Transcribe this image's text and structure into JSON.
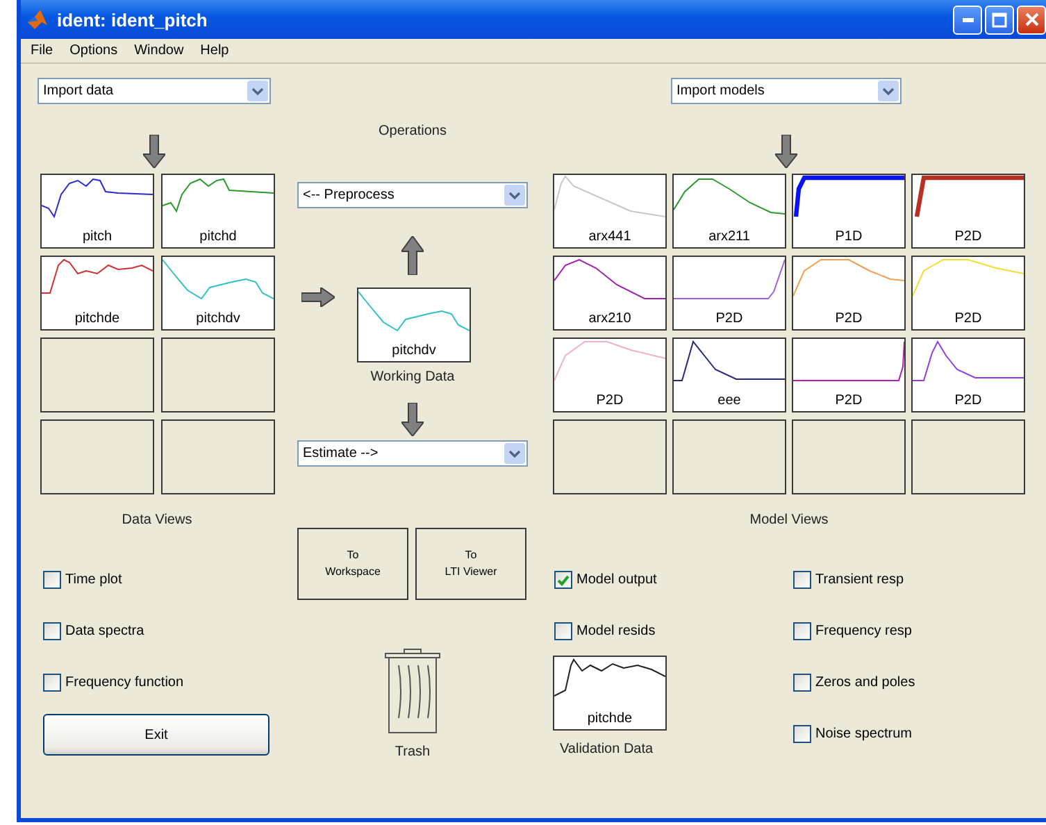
{
  "window": {
    "title": "ident: ident_pitch"
  },
  "menu": [
    "File",
    "Options",
    "Window",
    "Help"
  ],
  "import_data": {
    "value": "Import data"
  },
  "import_models": {
    "value": "Import models"
  },
  "operations": {
    "title": "Operations",
    "preprocess": "<-- Preprocess",
    "estimate": "Estimate -->"
  },
  "data_tiles": [
    {
      "kind": "plot",
      "label": "pitch",
      "color": "#2a2ad0",
      "active": false
    },
    {
      "kind": "plot",
      "label": "pitchd",
      "color": "#2a9a2a",
      "active": false
    },
    {
      "kind": "plot",
      "label": "pitchde",
      "color": "#d03030",
      "active": false
    },
    {
      "kind": "plot",
      "label": "pitchdv",
      "color": "#30c0c8",
      "active": false
    },
    {
      "kind": "empty"
    },
    {
      "kind": "empty"
    },
    {
      "kind": "empty"
    },
    {
      "kind": "empty"
    }
  ],
  "working_data": {
    "label": "pitchdv",
    "color": "#30c0c8",
    "caption": "Working Data"
  },
  "model_tiles": [
    {
      "kind": "plot",
      "label": "arx441",
      "color": "#c8c8c8",
      "active": false
    },
    {
      "kind": "plot",
      "label": "arx211",
      "color": "#2a9a2a",
      "active": false
    },
    {
      "kind": "plot",
      "label": "P1D",
      "color": "#0a14f0",
      "active": true
    },
    {
      "kind": "plot",
      "label": "P2D",
      "color": "#b83020",
      "active": true
    },
    {
      "kind": "plot",
      "label": "arx210",
      "color": "#a020b0",
      "active": false
    },
    {
      "kind": "plot",
      "label": "P2D",
      "color": "#a060e0",
      "active": false
    },
    {
      "kind": "plot",
      "label": "P2D",
      "color": "#f0a050",
      "active": false
    },
    {
      "kind": "plot",
      "label": "P2D",
      "color": "#f0e030",
      "active": false
    },
    {
      "kind": "plot",
      "label": "P2D",
      "color": "#f0b0c8",
      "active": false
    },
    {
      "kind": "plot",
      "label": "eee",
      "color": "#282880",
      "active": false
    },
    {
      "kind": "plot",
      "label": "P2D",
      "color": "#b020b0",
      "active": false
    },
    {
      "kind": "plot",
      "label": "P2D",
      "color": "#9040e0",
      "active": false
    },
    {
      "kind": "empty"
    },
    {
      "kind": "empty"
    },
    {
      "kind": "empty"
    },
    {
      "kind": "empty"
    }
  ],
  "data_views": {
    "title": "Data Views",
    "options": [
      {
        "label": "Time plot",
        "checked": false
      },
      {
        "label": "Data spectra",
        "checked": false
      },
      {
        "label": "Frequency function",
        "checked": false
      }
    ]
  },
  "exit_button": "Exit",
  "export_buttons": [
    [
      "To",
      "Workspace"
    ],
    [
      "To",
      "LTI Viewer"
    ]
  ],
  "trash": {
    "label": "Trash"
  },
  "model_views": {
    "title": "Model Views",
    "left_options": [
      {
        "label": "Model output",
        "checked": true
      },
      {
        "label": "Model resids",
        "checked": false
      }
    ],
    "right_options": [
      {
        "label": "Transient resp",
        "checked": false
      },
      {
        "label": "Frequency resp",
        "checked": false
      },
      {
        "label": "Zeros and poles",
        "checked": false
      },
      {
        "label": "Noise spectrum",
        "checked": false
      }
    ]
  },
  "validation_data": {
    "label": "pitchde",
    "color": "#202020",
    "caption": "Validation Data"
  }
}
